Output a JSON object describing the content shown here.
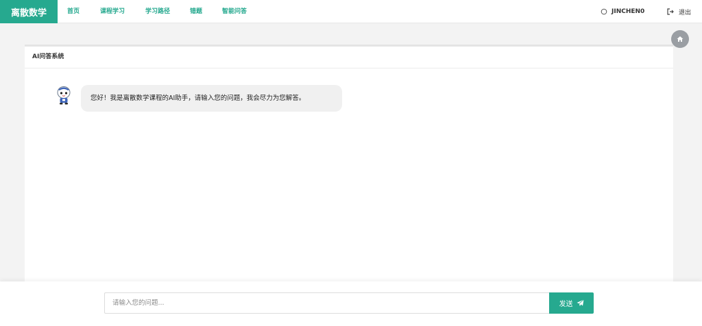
{
  "navbar": {
    "brand": "离散数学",
    "items": [
      {
        "label": "首页"
      },
      {
        "label": "课程学习"
      },
      {
        "label": "学习路径"
      },
      {
        "label": "错题"
      },
      {
        "label": "智能问答"
      }
    ],
    "user": {
      "name": "JINCHEN0",
      "icon": "user-icon"
    },
    "logout": {
      "label": "退出",
      "icon": "logout-icon"
    }
  },
  "home_button": {
    "icon": "home-icon"
  },
  "panel": {
    "title": "AI问答系统",
    "messages": [
      {
        "sender": "assistant",
        "avatar": "robot-avatar",
        "text": "您好！我是离散数学课程的AI助手，请输入您的问题，我会尽力为您解答。"
      }
    ]
  },
  "composer": {
    "placeholder": "请输入您的问题...",
    "value": "",
    "send_label": "发送",
    "send_icon": "paper-plane-icon"
  },
  "colors": {
    "accent": "#26a98f",
    "page_bg": "#f3f3f3",
    "bubble_bg": "#f0f0f0",
    "fab_bg": "#9a9ea3"
  }
}
